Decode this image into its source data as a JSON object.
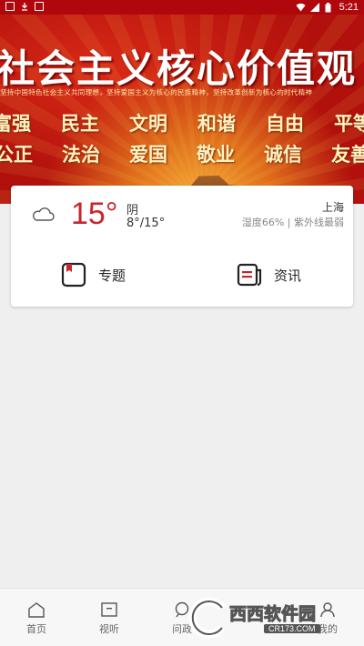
{
  "status_bar": {
    "time": "5:21"
  },
  "banner": {
    "title": "社会主义核心价值观",
    "subline": "坚持中国特色社会主义共同理想，坚持爱国主义为核心的民族精神，坚持改革创新为核心的时代精神",
    "values_row1": [
      "富强",
      "民主",
      "文明",
      "和谐",
      "自由",
      "平等"
    ],
    "values_row2": [
      "公正",
      "法治",
      "爱国",
      "敬业",
      "诚信",
      "友善"
    ]
  },
  "weather": {
    "icon": "cloud-icon",
    "temperature": "15°",
    "condition": "阴",
    "range": "8°/15°",
    "city": "上海",
    "details": "湿度66% | 紫外线最弱",
    "temp_color": "#c7262c"
  },
  "shortcuts": [
    {
      "label": "专题",
      "icon": "book-icon"
    },
    {
      "label": "资讯",
      "icon": "news-icon"
    }
  ],
  "bottom_nav": [
    {
      "label": "首页",
      "icon": "home-icon"
    },
    {
      "label": "视听",
      "icon": "video-icon"
    },
    {
      "label": "问政",
      "icon": "chat-icon"
    },
    {
      "label": "我的",
      "icon": "user-icon"
    }
  ],
  "watermark": {
    "text": "西西软件园",
    "url": "CR173.COM"
  },
  "colors": {
    "status_bar": "#b0070c",
    "accent": "#c7262c",
    "background": "#efefef"
  }
}
